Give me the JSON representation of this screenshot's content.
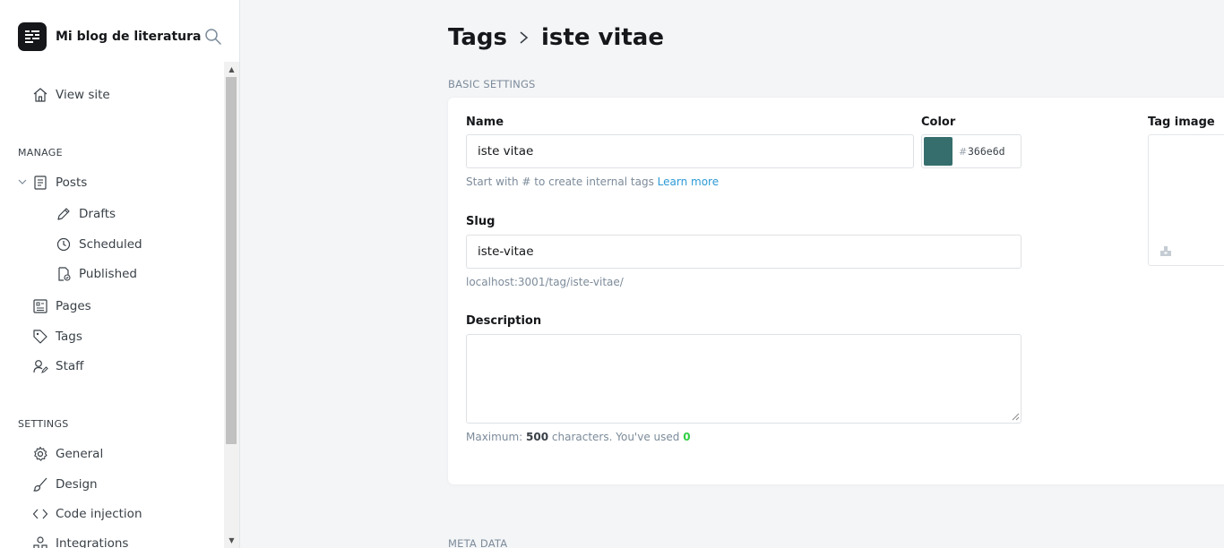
{
  "sidebar": {
    "site_name": "Mi blog de literatura",
    "view_site": "View site",
    "manage_title": "MANAGE",
    "posts": "Posts",
    "drafts": "Drafts",
    "scheduled": "Scheduled",
    "published": "Published",
    "pages": "Pages",
    "tags": "Tags",
    "staff": "Staff",
    "settings_title": "SETTINGS",
    "general": "General",
    "design": "Design",
    "code_injection": "Code injection",
    "integrations": "Integrations"
  },
  "breadcrumb": {
    "parent": "Tags",
    "current": "iste vitae"
  },
  "basic_settings": {
    "title": "BASIC SETTINGS",
    "name_label": "Name",
    "name_value": "iste vitae",
    "name_hint": "Start with # to create internal tags",
    "learn_more": "Learn more",
    "color_label": "Color",
    "color_hash": "#",
    "color_value": "366e6d",
    "color_hex": "#366e6d",
    "tag_image_label": "Tag image",
    "slug_label": "Slug",
    "slug_value": "iste-vitae",
    "slug_url": "localhost:3001/tag/iste-vitae/",
    "description_label": "Description",
    "description_value": "",
    "max_prefix": "Maximum:",
    "max_count": "500",
    "max_middle": "characters. You've used",
    "used_count": "0"
  },
  "meta_data": {
    "title": "META DATA"
  }
}
